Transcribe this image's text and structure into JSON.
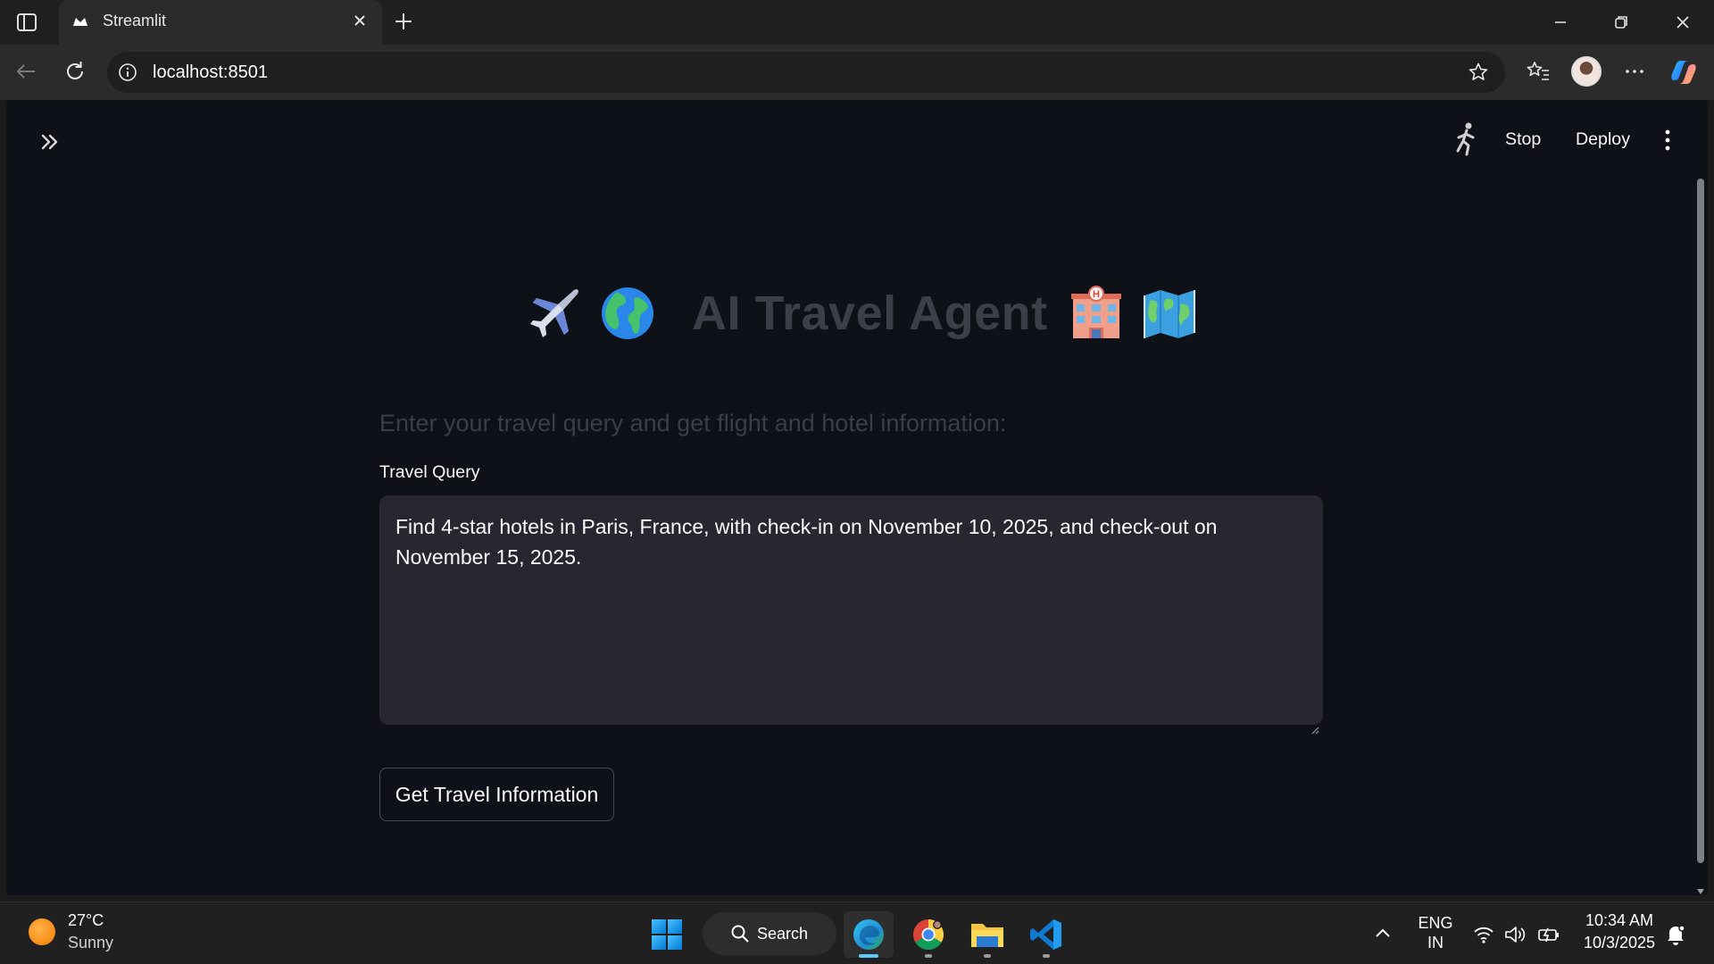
{
  "browser": {
    "tab_title": "Streamlit",
    "url": "localhost:8501"
  },
  "app_header": {
    "stop_label": "Stop",
    "deploy_label": "Deploy"
  },
  "main": {
    "title": "AI Travel Agent",
    "title_emojis": [
      "airplane",
      "globe",
      "hotel",
      "world-map"
    ],
    "subtitle": "Enter your travel query and get flight and hotel information:",
    "query_label": "Travel Query",
    "query_value": "Find 4-star hotels in Paris, France, with check-in on November 10, 2025, and check-out on November 15, 2025.",
    "submit_label": "Get Travel Information"
  },
  "taskbar": {
    "weather_temp": "27°C",
    "weather_desc": "Sunny",
    "search_label": "Search",
    "lang_top": "ENG",
    "lang_bottom": "IN",
    "time": "10:34 AM",
    "date": "10/3/2025"
  },
  "colors": {
    "page_bg": "#0e1117",
    "input_bg": "#262730",
    "title_text": "#3b3f48",
    "taskbar_bg": "#202020"
  }
}
